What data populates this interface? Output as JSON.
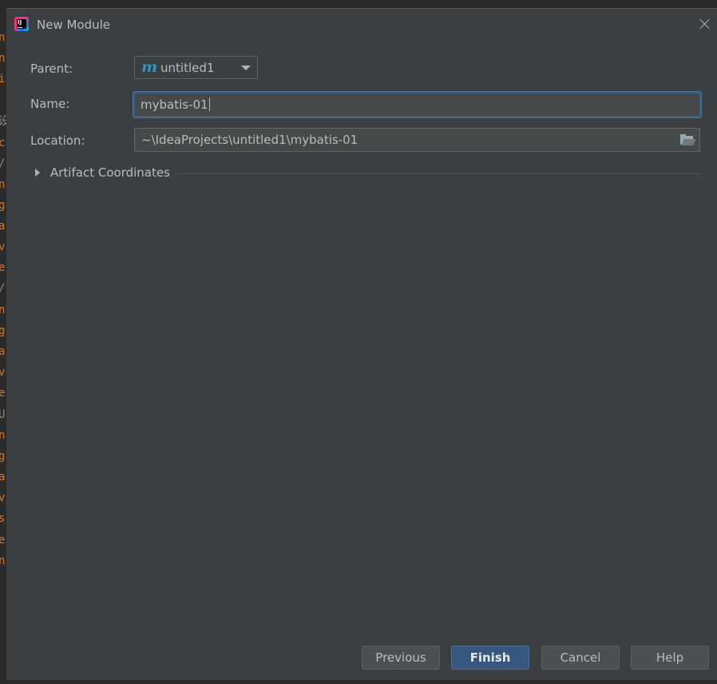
{
  "background_editor": {
    "visible_chars": [
      "n",
      "n",
      "i",
      "设",
      "c",
      "/",
      "n",
      "g",
      "a",
      "v",
      "e",
      "/",
      "n",
      "g",
      "a",
      "v",
      "e",
      "U",
      "n",
      "g",
      "a",
      "v",
      "s",
      "e",
      "n"
    ]
  },
  "dialog": {
    "title": "New Module",
    "parent": {
      "label": "Parent:",
      "value": "untitled1",
      "icon": "maven-module-icon"
    },
    "name": {
      "label": "Name:",
      "value": "mybatis-01"
    },
    "location": {
      "label": "Location:",
      "value": "~\\IdeaProjects\\untitled1\\mybatis-01"
    },
    "artifact": {
      "label": "Artifact Coordinates",
      "expanded": false
    },
    "buttons": {
      "previous": "Previous",
      "finish": "Finish",
      "cancel": "Cancel",
      "help": "Help"
    }
  },
  "colors": {
    "dialog_bg": "#3c3f41",
    "field_bg": "#45494a",
    "focus_border": "#3d6185",
    "primary_button": "#365880",
    "maven_icon": "#3592c4",
    "editor_text": "#cc7832"
  }
}
